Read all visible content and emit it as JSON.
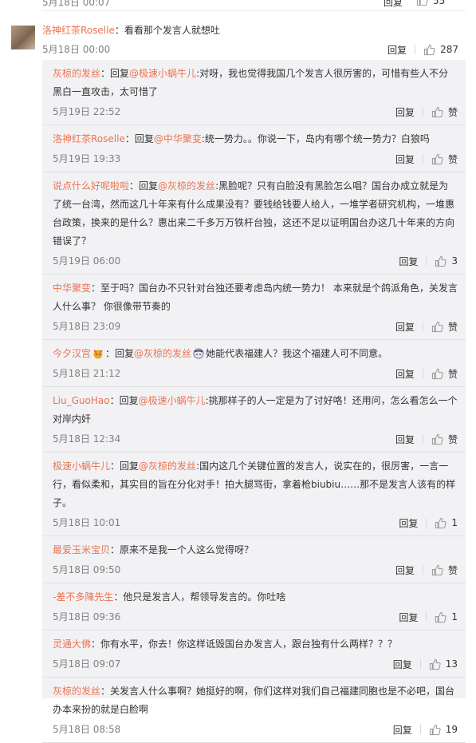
{
  "top": {
    "date": "5月18日 00:07",
    "reply_label": "回复",
    "likes": "55"
  },
  "root": {
    "user": "洛神红茶Roselle",
    "sep": "：",
    "text": "看看那个发言人就想吐",
    "time": "5月18日 00:00",
    "reply_label": "回复",
    "likes": "287"
  },
  "replies": [
    {
      "user": "灰椋的发丝",
      "sep": "：",
      "reply_prefix": "回复",
      "target": "@极速小蜗牛儿",
      "text": ":对呀，我也觉得我国几个发言人很厉害的，可惜有些人不分黑白一直攻击，太可惜了",
      "time": "5月19日 22:52",
      "reply_label": "回复",
      "likes": "赞"
    },
    {
      "user": "洛神红茶Roselle",
      "sep": "：",
      "reply_prefix": "回复",
      "target": "@中华聚变",
      "text": ":统一势力。。你说一下，岛内有哪个统一势力？白狼吗",
      "time": "5月19日 19:33",
      "reply_label": "回复",
      "likes": "赞"
    },
    {
      "user": "说点什么好呢啦啦",
      "sep": "：",
      "reply_prefix": "回复",
      "target": "@灰椋的发丝",
      "text": ":黑脸呢？只有白脸没有黑脸怎么唱？国台办成立就是为了统一台湾，然而这几十年来有什么成果没有？要钱给钱要人给人，一堆学者研究机构，一堆惠台政策，换来的是什么？惠出来二千多万万铁杆台独，这还不足以证明国台办这几十年来的方向错误了？",
      "time": "5月19日 06:00",
      "reply_label": "回复",
      "likes": "3"
    },
    {
      "user": "中华聚变",
      "sep": "：",
      "text": "至于吗？国台办不只针对台独还要考虑岛内统一势力！ 本来就是个鸽派角色，关发言人什么事？ 你很像带节奏的",
      "time": "5月18日 23:09",
      "reply_label": "回复",
      "likes": "赞"
    },
    {
      "user": "今夕汉宫",
      "badge": true,
      "sep": "：",
      "reply_prefix": "回复",
      "target": "@灰椋的发丝",
      "face": true,
      "text": "她能代表福建人？我这个福建人可不同意。",
      "time": "5月18日 21:12",
      "reply_label": "回复",
      "likes": "赞"
    },
    {
      "user": "Liu_GuoHao",
      "sep": "：",
      "reply_prefix": "回复",
      "target": "@极速小蜗牛儿",
      "text": ":挑那样子的人一定是为了讨好咯！还用问，怎么看怎么一个对岸内奸",
      "time": "5月18日 12:34",
      "reply_label": "回复",
      "likes": "赞"
    },
    {
      "user": "极速小蜗牛儿",
      "sep": "：",
      "reply_prefix": "回复",
      "target": "@灰椋的发丝",
      "text": ":国内这几个关键位置的发言人，说实在的，很厉害，一言一行，看似柔和，其实目的旨在分化对手！拍大腿骂街，拿着枪biubiu……那不是发言人该有的样子。",
      "time": "5月18日 10:01",
      "reply_label": "回复",
      "likes": "1"
    },
    {
      "user": "最爱玉米宝贝",
      "sep": "：",
      "text": "原来不是我一个人这么觉得呀？",
      "time": "5月18日 09:50",
      "reply_label": "回复",
      "likes": "赞"
    },
    {
      "user": "-差不多陳先生",
      "sep": "：",
      "text": "他只是发言人，帮领导发言的。你吐啥",
      "time": "5月18日 09:36",
      "reply_label": "回复",
      "likes": "1"
    },
    {
      "user": "灵通大佛",
      "sep": "：",
      "text": "你有水平，你去！你这样诋毁国台办发言人，跟台独有什么两样？？？",
      "time": "5月18日 09:07",
      "reply_label": "回复",
      "likes": "13"
    },
    {
      "user": "灰椋的发丝",
      "sep": "：",
      "text": "关发言人什么事啊？她挺好的啊，你们这样对我们自己福建同胞也是不必吧，国台办本来扮的就是白脸啊",
      "time": "5月18日 08:58",
      "reply_label": "回复",
      "likes": "19"
    }
  ]
}
